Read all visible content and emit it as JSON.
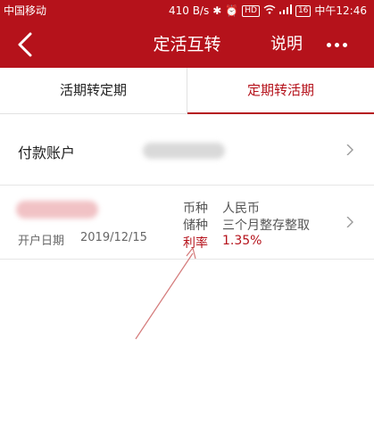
{
  "status_bar": {
    "carrier": "中国移动",
    "speed": "410 B/s",
    "hd": "HD",
    "battery": "16",
    "time": "中午12:46"
  },
  "nav": {
    "title": "定活互转",
    "help_label": "说明"
  },
  "tabs": [
    {
      "label": "活期转定期",
      "active": false
    },
    {
      "label": "定期转活期",
      "active": true
    }
  ],
  "account": {
    "label": "付款账户"
  },
  "deposit": {
    "open_date_label": "开户日期",
    "open_date": "2019/12/15",
    "currency_label": "币种",
    "currency": "人民币",
    "type_label": "储种",
    "type": "三个月整存整取",
    "rate_label": "利率",
    "rate": "1.35%"
  },
  "colors": {
    "brand_red": "#b5121b",
    "arrow": "#d47a7a"
  }
}
